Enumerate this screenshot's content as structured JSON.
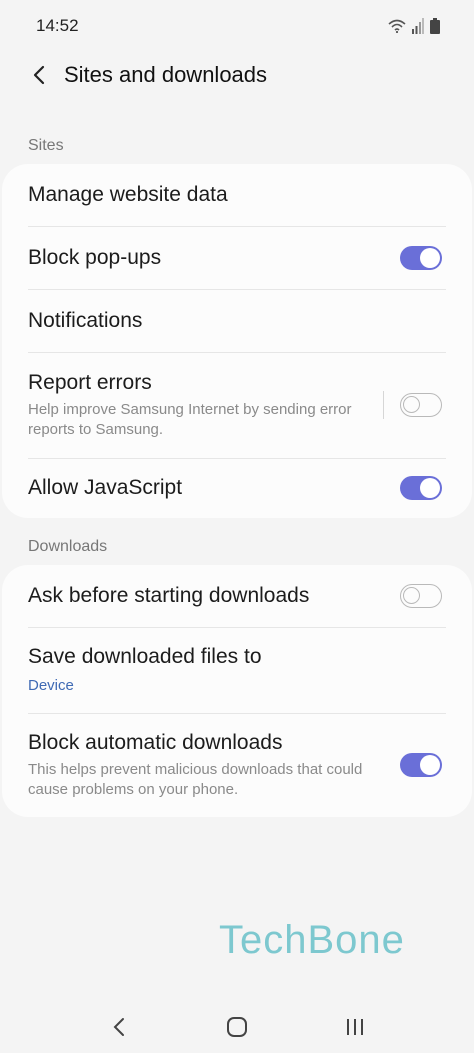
{
  "status_bar": {
    "time": "14:52",
    "icons": [
      "wifi-icon",
      "signal-icon",
      "battery-icon"
    ]
  },
  "header": {
    "title": "Sites and downloads",
    "back_icon": "chevron-left-icon"
  },
  "sections": {
    "sites": {
      "label": "Sites",
      "items": [
        {
          "title": "Manage website data"
        },
        {
          "title": "Block pop-ups",
          "toggle": true
        },
        {
          "title": "Notifications"
        },
        {
          "title": "Report errors",
          "subtitle": "Help improve Samsung Internet by sending error reports to Samsung.",
          "toggle": false
        },
        {
          "title": "Allow JavaScript",
          "toggle": true
        }
      ]
    },
    "downloads": {
      "label": "Downloads",
      "items": [
        {
          "title": "Ask before starting downloads",
          "toggle": false
        },
        {
          "title": "Save downloaded files to",
          "value": "Device"
        },
        {
          "title": "Block automatic downloads",
          "subtitle": "This helps prevent malicious downloads that could cause problems on your phone.",
          "toggle": true
        }
      ]
    }
  },
  "watermark": "TechBone",
  "nav_bar": {
    "icons": [
      "back-icon",
      "home-icon",
      "recents-icon"
    ]
  },
  "colors": {
    "accent": "#6a6fd8",
    "link": "#3f6ab4",
    "background": "#f4f4f4",
    "card": "#fcfcfc",
    "watermark": "#7dc8cf"
  }
}
